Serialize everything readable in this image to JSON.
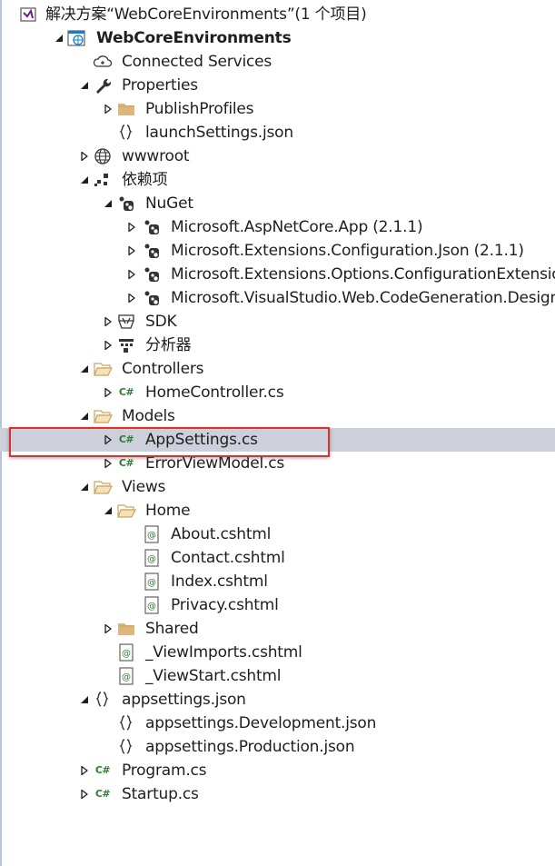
{
  "solution_explorer": {
    "highlight_color": "#d6342c",
    "selection_color": "#cdd0db",
    "rows": [
      {
        "label": "解决方案“WebCoreEnvironments”(1 个项目)",
        "icon": "solution-icon",
        "arrow": "none",
        "level": 0,
        "name": "solution-root"
      },
      {
        "label": "WebCoreEnvironments",
        "icon": "web-project-icon",
        "arrow": "expanded",
        "level": 1,
        "bold": true,
        "name": "project-webcoreenvironments"
      },
      {
        "label": "Connected Services",
        "icon": "connected-services-icon",
        "arrow": "none",
        "level": 2,
        "name": "node-connected-services"
      },
      {
        "label": "Properties",
        "icon": "wrench-icon",
        "arrow": "expanded",
        "level": 2,
        "name": "node-properties"
      },
      {
        "label": "PublishProfiles",
        "icon": "folder-icon",
        "arrow": "collapsed",
        "level": 3,
        "name": "node-publishprofiles"
      },
      {
        "label": "launchSettings.json",
        "icon": "json-file-icon",
        "arrow": "none",
        "level": 3,
        "name": "file-launchsettings-json"
      },
      {
        "label": "wwwroot",
        "icon": "globe-icon",
        "arrow": "collapsed",
        "level": 2,
        "name": "node-wwwroot"
      },
      {
        "label": "依赖项",
        "icon": "dependencies-icon",
        "arrow": "expanded",
        "level": 2,
        "name": "node-dependencies"
      },
      {
        "label": "NuGet",
        "icon": "nuget-icon",
        "arrow": "expanded",
        "level": 3,
        "name": "node-nuget"
      },
      {
        "label": "Microsoft.AspNetCore.App (2.1.1)",
        "icon": "nuget-icon",
        "arrow": "collapsed",
        "level": 4,
        "name": "package-aspnetcore-app"
      },
      {
        "label": "Microsoft.Extensions.Configuration.Json (2.1.1)",
        "icon": "nuget-icon",
        "arrow": "collapsed",
        "level": 4,
        "name": "package-configuration-json"
      },
      {
        "label": "Microsoft.Extensions.Options.ConfigurationExtensions",
        "icon": "nuget-icon",
        "arrow": "collapsed",
        "level": 4,
        "name": "package-options-configurationextensions"
      },
      {
        "label": "Microsoft.VisualStudio.Web.CodeGeneration.Design",
        "icon": "nuget-icon",
        "arrow": "collapsed",
        "level": 4,
        "name": "package-codegeneration-design"
      },
      {
        "label": "SDK",
        "icon": "sdk-icon",
        "arrow": "collapsed",
        "level": 3,
        "name": "node-sdk"
      },
      {
        "label": "分析器",
        "icon": "analyzer-icon",
        "arrow": "collapsed",
        "level": 3,
        "name": "node-analyzers"
      },
      {
        "label": "Controllers",
        "icon": "folder-open-icon",
        "arrow": "expanded",
        "level": 2,
        "name": "node-controllers"
      },
      {
        "label": "HomeController.cs",
        "icon": "csharp-file-icon",
        "arrow": "collapsed",
        "level": 3,
        "name": "file-homecontroller-cs"
      },
      {
        "label": "Models",
        "icon": "folder-open-icon",
        "arrow": "expanded",
        "level": 2,
        "name": "node-models"
      },
      {
        "label": "AppSettings.cs",
        "icon": "csharp-file-icon",
        "arrow": "collapsed",
        "level": 3,
        "selected": true,
        "name": "file-appsettings-cs"
      },
      {
        "label": "ErrorViewModel.cs",
        "icon": "csharp-file-icon",
        "arrow": "collapsed",
        "level": 3,
        "name": "file-errorviewmodel-cs"
      },
      {
        "label": "Views",
        "icon": "folder-open-icon",
        "arrow": "expanded",
        "level": 2,
        "name": "node-views"
      },
      {
        "label": "Home",
        "icon": "folder-open-icon",
        "arrow": "expanded",
        "level": 3,
        "name": "node-views-home"
      },
      {
        "label": "About.cshtml",
        "icon": "razor-file-icon",
        "arrow": "none",
        "level": 4,
        "name": "file-about-cshtml"
      },
      {
        "label": "Contact.cshtml",
        "icon": "razor-file-icon",
        "arrow": "none",
        "level": 4,
        "name": "file-contact-cshtml"
      },
      {
        "label": "Index.cshtml",
        "icon": "razor-file-icon",
        "arrow": "none",
        "level": 4,
        "name": "file-index-cshtml"
      },
      {
        "label": "Privacy.cshtml",
        "icon": "razor-file-icon",
        "arrow": "none",
        "level": 4,
        "name": "file-privacy-cshtml"
      },
      {
        "label": "Shared",
        "icon": "folder-icon",
        "arrow": "collapsed",
        "level": 3,
        "name": "node-views-shared"
      },
      {
        "label": "_ViewImports.cshtml",
        "icon": "razor-file-icon",
        "arrow": "none",
        "level": 3,
        "name": "file-viewimports-cshtml"
      },
      {
        "label": "_ViewStart.cshtml",
        "icon": "razor-file-icon",
        "arrow": "none",
        "level": 3,
        "name": "file-viewstart-cshtml"
      },
      {
        "label": "appsettings.json",
        "icon": "json-file-icon",
        "arrow": "expanded",
        "level": 2,
        "name": "file-appsettings-json"
      },
      {
        "label": "appsettings.Development.json",
        "icon": "json-file-icon",
        "arrow": "none",
        "level": 3,
        "name": "file-appsettings-development-json"
      },
      {
        "label": "appsettings.Production.json",
        "icon": "json-file-icon",
        "arrow": "none",
        "level": 3,
        "name": "file-appsettings-production-json"
      },
      {
        "label": "Program.cs",
        "icon": "csharp-file-icon",
        "arrow": "collapsed",
        "level": 2,
        "name": "file-program-cs"
      },
      {
        "label": "Startup.cs",
        "icon": "csharp-file-icon",
        "arrow": "collapsed",
        "level": 2,
        "name": "file-startup-cs"
      }
    ]
  }
}
